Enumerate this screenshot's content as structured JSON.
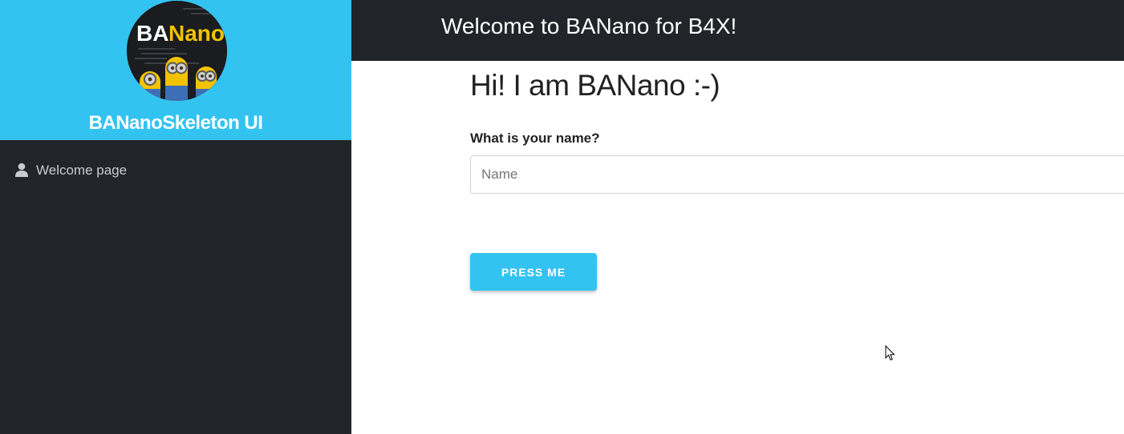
{
  "sidebar": {
    "logo_text": "BANano",
    "title": "BANanoSkeleton UI",
    "items": [
      {
        "label": "Welcome page",
        "icon": "user-icon"
      }
    ]
  },
  "topbar": {
    "title": "Welcome to BANano for B4X!"
  },
  "main": {
    "heading": "Hi! I am BANano :-)",
    "name_field": {
      "label": "What is your name?",
      "placeholder": "Name"
    },
    "press_button_label": "PRESS ME"
  },
  "colors": {
    "accent": "#33c3f0",
    "dark": "#212429",
    "sidebar_text": "#c8ccd1",
    "logo_banana_yellow": "#f2c200"
  }
}
